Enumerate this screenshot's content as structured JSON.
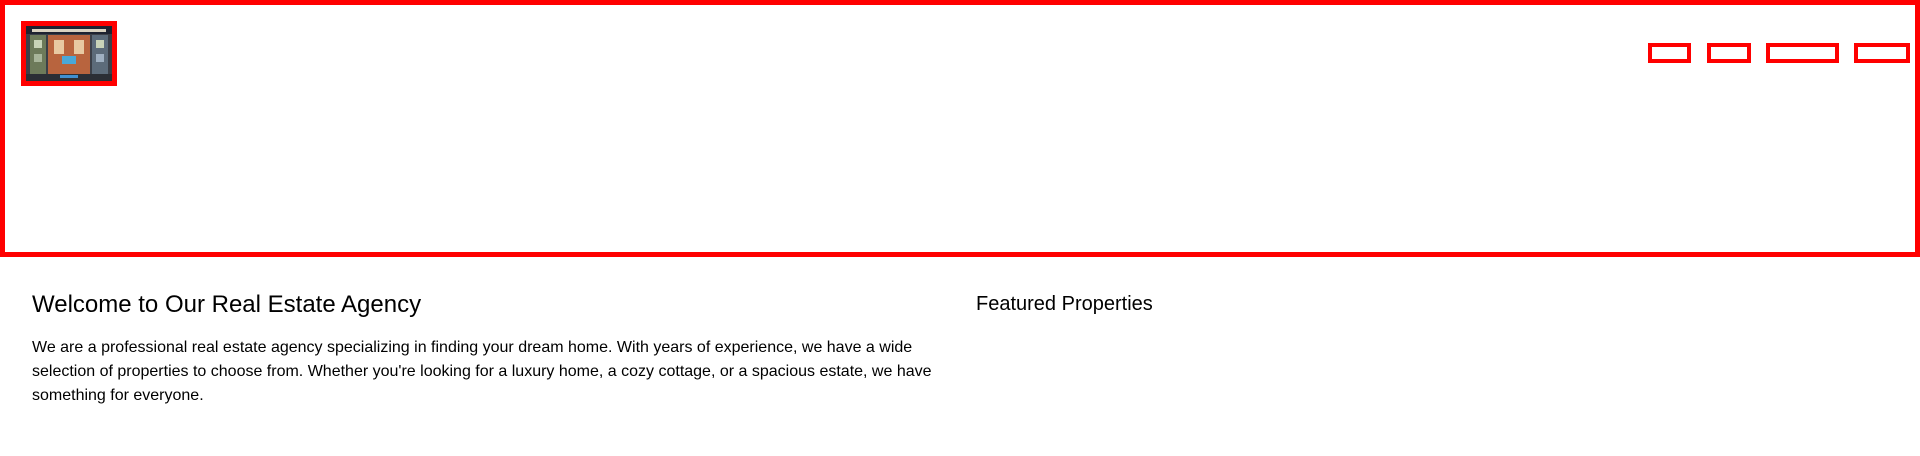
{
  "header": {
    "logo_icon": "real-estate-logo-image",
    "border_color": "#ff0000",
    "nav_items": [
      {
        "label": ""
      },
      {
        "label": ""
      },
      {
        "label": ""
      },
      {
        "label": ""
      }
    ]
  },
  "main": {
    "welcome_title": "Welcome to Our Real Estate Agency",
    "welcome_text": "We are a professional real estate agency specializing in finding your dream home. With years of experience, we have a wide selection of properties to choose from. Whether you're looking for a luxury home, a cozy cottage, or a spacious estate, we have something for everyone.",
    "featured_title": "Featured Properties"
  }
}
